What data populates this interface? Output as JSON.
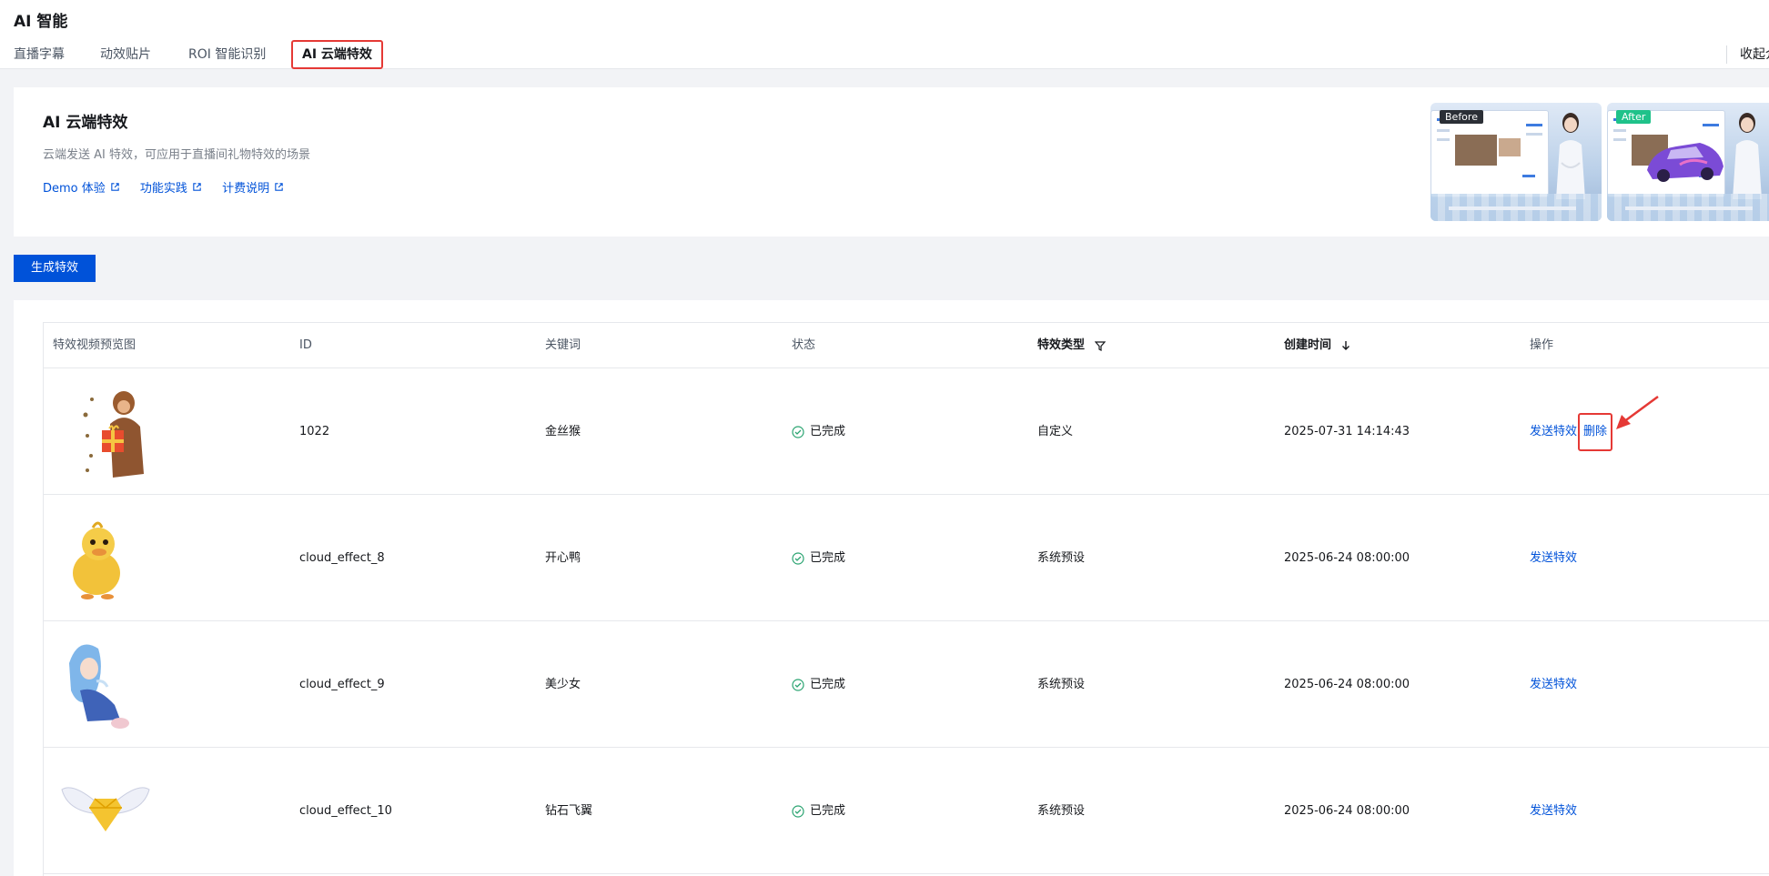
{
  "header": {
    "title": "AI 智能",
    "tabs": [
      {
        "label": "直播字幕",
        "active": false
      },
      {
        "label": "动效贴片",
        "active": false
      },
      {
        "label": "ROI 智能识别",
        "active": false
      },
      {
        "label": "AI 云端特效",
        "active": true
      }
    ],
    "collapse_label": "收起介绍"
  },
  "intro": {
    "title": "AI 云端特效",
    "description": "云端发送 AI 特效，可应用于直播间礼物特效的场景",
    "links": [
      "Demo 体验",
      "功能实践",
      "计费说明"
    ],
    "preview_before_label": "Before",
    "preview_after_label": "After"
  },
  "toolbar": {
    "generate_label": "生成特效"
  },
  "table": {
    "columns": [
      {
        "label": "特效视频预览图"
      },
      {
        "label": "ID"
      },
      {
        "label": "关键词"
      },
      {
        "label": "状态"
      },
      {
        "label": "特效类型",
        "icon": "filter-icon"
      },
      {
        "label": "创建时间",
        "icon": "sort-down-icon"
      },
      {
        "label": "操作"
      }
    ],
    "rows": [
      {
        "thumb": "monkey-gift",
        "id": "1022",
        "keyword": "金丝猴",
        "status": "已完成",
        "type": "自定义",
        "created": "2025-07-31 14:14:43",
        "actions": [
          "发送特效",
          "删除"
        ]
      },
      {
        "thumb": "duck",
        "id": "cloud_effect_8",
        "keyword": "开心鸭",
        "status": "已完成",
        "type": "系统预设",
        "created": "2025-06-24 08:00:00",
        "actions": [
          "发送特效"
        ]
      },
      {
        "thumb": "anime-girl",
        "id": "cloud_effect_9",
        "keyword": "美少女",
        "status": "已完成",
        "type": "系统预设",
        "created": "2025-06-24 08:00:00",
        "actions": [
          "发送特效"
        ]
      },
      {
        "thumb": "diamond-wings",
        "id": "cloud_effect_10",
        "keyword": "钻石飞翼",
        "status": "已完成",
        "type": "系统预设",
        "created": "2025-06-24 08:00:00",
        "actions": [
          "发送特效"
        ]
      }
    ]
  },
  "colors": {
    "primary": "#0052d9",
    "success": "#2ba471",
    "highlight": "#e53935",
    "before_badge": "#2b2f36",
    "after_badge": "#1fc28a"
  }
}
